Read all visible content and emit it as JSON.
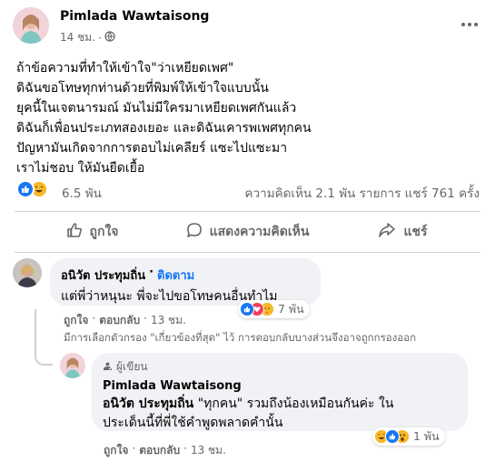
{
  "post": {
    "author": "Pimlada Wawtaisong",
    "time": "14 ชม.",
    "meta_sep": "·",
    "lines": [
      "ถ้าข้อความที่ทำให้เข้าใจ\"ว่าเหยียดเพศ\"",
      "ดิฉันขอโทษทุกท่านด้วยที่พิมพ์ให้เข้าใจแบบนั้น",
      "ยุคนี้ในเจตนารมณ์ มันไม่มีใครมาเหยียดเพศกันแล้ว",
      "ดิฉันก็เพื่อนประเภทสองเยอะ และดิฉันเคารพเพศทุกคน",
      "ปัญหามันเกิดจากการตอบไม่เคลียร์ แซะไปแซะมา",
      "เราไม่ชอบ ให้มันยืดเยื้อ"
    ],
    "reaction_count": "6.5 พัน",
    "stats": "ความคิดเห็น 2.1 พัน รายการ  แชร์ 761 ครั้ง"
  },
  "actions": {
    "like": "ถูกใจ",
    "comment": "แสดงความคิดเห็น",
    "share": "แชร์"
  },
  "comment_1": {
    "author": "อนิวัต ประทุมถิ่น",
    "sep": "·",
    "follow": "ติดตาม",
    "text": "แต่พี่ว่าหนุนะ พี่จะไปขอโทษคนอื่นทำไม",
    "reaction_count": "7 พัน",
    "like": "ถูกใจ",
    "sep2": "·",
    "reply": "ตอบกลับ",
    "sep3": "·",
    "time": "13 ชม."
  },
  "filter_notice": "มีการเลือกตัวกรอง \"เกี่ยวข้องที่สุด\" ไว้ การตอบกลับบางส่วนจึงอาจถูกกรองออก",
  "reply": {
    "badge": "ผู้เขียน",
    "author": "Pimlada Wawtaisong",
    "mention": "อนิวัต ประทุมถิ่น",
    "text_1": " \"ทุกคน\" รวมถึงน้องเหมือนกันค่ะ ใน",
    "text_2": "ประเด็นนี้ที่พี่ใช้คำพูดพลาดคำนั้น",
    "reaction_count": "1 พัน",
    "like": "ถูกใจ",
    "sep": "·",
    "reply": "ตอบกลับ",
    "sep2": "·",
    "time": "13 ชม."
  },
  "colors": {
    "link": "#1877f2",
    "secondary_text": "#65676b",
    "bubble": "#f0f2f5"
  },
  "icons": [
    "globe-icon",
    "more-icon",
    "like-icon",
    "comment-icon",
    "share-icon",
    "author-badge-icon"
  ]
}
